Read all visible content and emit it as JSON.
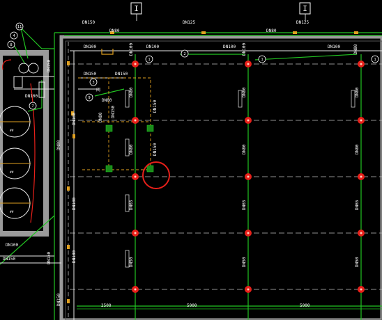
{
  "colors": {
    "background": "#000000",
    "wall": "#9a9a9a",
    "pipe_green": "#22c522",
    "pipe_white": "#e8e8e8",
    "column_red": "#e8201a",
    "highlight_circle": "#e8201a",
    "valve_orange": "#e0a020",
    "sprinkler_green": "#1a8a1a",
    "dashed_axis": "#bfbfbf"
  },
  "section_markers": [
    "I",
    "I"
  ],
  "pipe_labels": {
    "top_left": "DN150",
    "top_mid": "DN125",
    "top_main_left": "DN80",
    "top_main_right": "DN80",
    "top_right": "DN125",
    "branch_1": "DN100",
    "branch_2": "DN100",
    "branch_3": "DN100",
    "branch_4": "DN100",
    "branch_5": "DN100",
    "branch_6": "DN100",
    "left_a": "DN150",
    "left_b": "DN150",
    "left_c": "DN80",
    "left_d": "DN80",
    "left_e": "DN100",
    "left_f": "DN100",
    "left_g": "DN100",
    "vert_l1": "DN150",
    "vert_l2": "DN150",
    "vert_l3": "DN80",
    "vert_mid_1": "DN80",
    "vert_mid_2": "DN80",
    "vert_mid_3": "DN65",
    "vert_mid_4": "DN50",
    "vert_r_1": "DN80",
    "vert_r_2": "DN80",
    "vert_r_3": "DN65",
    "vert_r_4": "DN50",
    "vert_c_1": "DN80",
    "vert_c_2": "DN80",
    "vert_c_3": "DN65",
    "vert_c_4": "DN50",
    "inner_a": "DN150",
    "inner_b": "DN80",
    "inner_c": "DN150",
    "inner_d": "DN150",
    "bottom_left_1": "DN100",
    "bottom_left_2": "DN150",
    "small_tag": "阀",
    "dn150_pump": "DN150",
    "dn100_pump": "DN100"
  },
  "callouts": [
    "11",
    "4",
    "8",
    "3",
    "9",
    "7",
    "1",
    "2",
    "1",
    "1"
  ],
  "dimensions": [
    "2500",
    "5000",
    "5000"
  ],
  "tank_labels": [
    "##",
    "##",
    "##"
  ]
}
